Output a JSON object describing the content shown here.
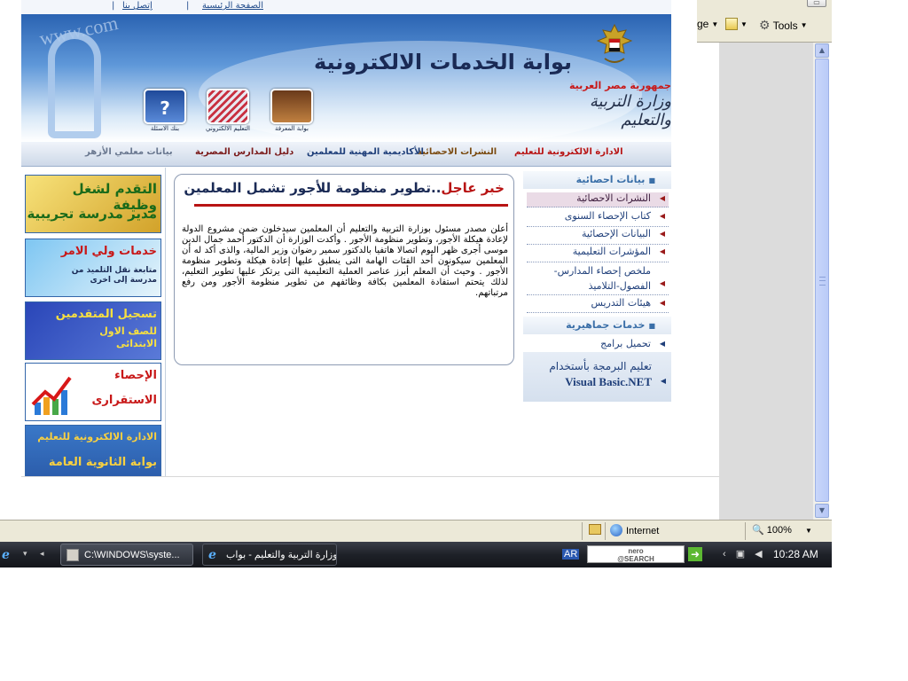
{
  "browser": {
    "toolbar": {
      "left_cut_label": "ge",
      "tools_label": "Tools"
    },
    "status": {
      "zone": "Internet",
      "zoom": "100%"
    }
  },
  "site": {
    "topnav": {
      "home": "الصفحة الرئيسية",
      "contact": "إتصل بنا",
      "separator": "|"
    },
    "banner": {
      "title": "بوابة الخدمات الالكترونية",
      "republic": "جمهورية مصر العربية",
      "ministry": "وزارة التربية والتعليم",
      "icons": [
        {
          "label": "بوابة المعرفة",
          "icon": "books-icon"
        },
        {
          "label": "التعليم الالكتروني",
          "icon": "keyboard-icon"
        },
        {
          "label": "بنك الاسئلة",
          "icon": "question-bank-icon"
        }
      ]
    },
    "mainnav": [
      {
        "label": "الادارة الالكترونية للتعليم",
        "color": "#b81414"
      },
      {
        "label": "النشرات الاحصائية",
        "color": "#7a4a10"
      },
      {
        "label": "الأكاديمية المهنية للمعلمين",
        "color": "#1f3f7a"
      },
      {
        "label": "دليل المدارس المصرية",
        "color": "#7a1a1a"
      },
      {
        "label": "بيانات معلمي الأزهر",
        "color": "#6a7890"
      }
    ],
    "ads": [
      {
        "line1": "التقدم لشغل وظيفة",
        "line2": "مدير مدرسة تجريبية"
      },
      {
        "line1": "خدمات ولي الامر",
        "line2": "متابعة نقل التلميذ من مدرسة إلى اخرى"
      },
      {
        "line1": "تسجيل المتقدمين",
        "line2": "للصف الاول الابتدائى"
      },
      {
        "line1": "الإحصاء",
        "line2": "الاستقرارى"
      },
      {
        "line1": "الادارة الالكترونية للتعليم",
        "line2": "بوابة الثانوية العامة"
      }
    ],
    "news": {
      "urgent": "خبر عاجل",
      "headline": "..تطوير منظومة للأجور تشمل المعلمين",
      "body": "أعلن مصدر مسئول بوزارة التربية والتعليم أن المعلمين سيدخلون ضمن مشروع الدولة لإعادة هيكلة الأجور، وتطوير منظومة الأجور . وأكدت الوزارة أن الدكتور أحمد جمال الدين موسى أجرى ظهر اليوم اتصالا هاتفيا بالدكتور سمير رضوان وزير المالية، والذى أكد له أن المعلمين سيكونون أحد الفئات الهامة التى ينطبق عليها إعادة هيكلة وتطوير منظومة الأجور . وحيث أن المعلم أبرز عناصر العملية التعليمية التى يرتكز عليها تطوير التعليم، لذلك يتحتم استفادة المعلمين بكافة وظائفهم من تطوير منظومة الأجور ومن رفع مرتباتهم."
    },
    "sidebar": {
      "section1": "بيانات احصائية",
      "items": [
        {
          "label": "النشرات الاحصائية",
          "active": true
        },
        {
          "label": "كتاب الإحصاء السنوى",
          "active": false
        },
        {
          "label": "البيانات الإحصائية",
          "active": false
        },
        {
          "label": "المؤشرات التعليمية",
          "active": false
        },
        {
          "label": "ملخص إحصاء المدارس-الفصول-التلاميذ",
          "active": false
        },
        {
          "label": "هيئات التدريس",
          "active": false
        }
      ],
      "section2": "خدمات جماهيرية",
      "programs": "تحميل برامج",
      "vb_line1": "تعليم البرمجة بأستخدام",
      "vb_line2": "Visual Basic.NET"
    }
  },
  "taskbar": {
    "tasks": [
      {
        "label": "C:\\WINDOWS\\syste..."
      },
      {
        "label": "وزارة التربية والتعليم - بواب..."
      }
    ],
    "lang": "AR",
    "nero_line1": "nero",
    "nero_line2": "@SEARCH",
    "clock": "10:28 AM"
  }
}
